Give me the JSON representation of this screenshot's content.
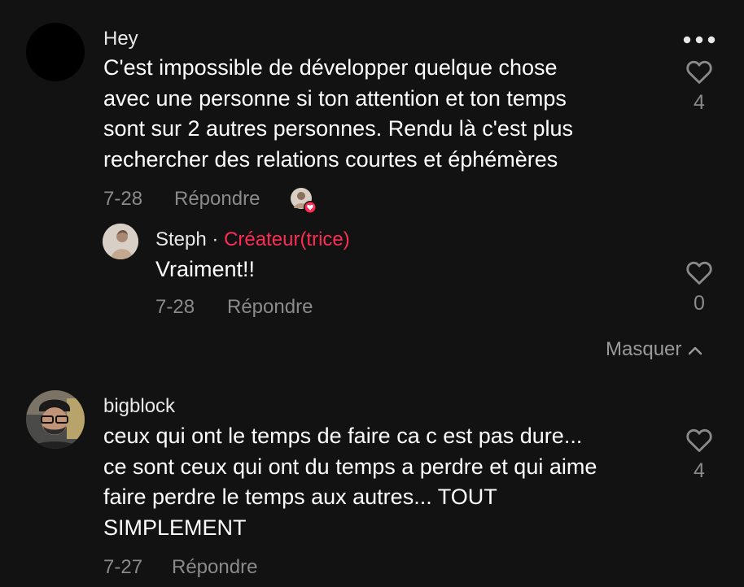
{
  "comments": [
    {
      "username": "Hey",
      "text_lines": [
        "C'est impossible de développer quelque chose",
        "avec une personne si ton attention et ton temps",
        "sont sur 2 autres personnes. Rendu là c'est plus",
        "rechercher des relations courtes et éphémères"
      ],
      "date": "7-28",
      "reply_label": "Répondre",
      "likes": "4",
      "replies": [
        {
          "username": "Steph",
          "separator": "·",
          "creator_label": "Créateur(trice)",
          "text_lines": [
            "Vraiment!!"
          ],
          "date": "7-28",
          "reply_label": "Répondre",
          "likes": "0"
        }
      ],
      "hide_label": "Masquer"
    },
    {
      "username": "bigblock",
      "text_lines": [
        "ceux qui ont le temps de faire ca c est pas dure...",
        "ce sont ceux qui ont du temps a perdre et qui aime",
        "faire perdre le temps aux autres... TOUT",
        "SIMPLEMENT"
      ],
      "date": "7-27",
      "reply_label": "Répondre",
      "likes": "4"
    }
  ],
  "colors": {
    "background": "#121212",
    "creator_accent": "#fe2c55",
    "muted_text": "#8a8a8a"
  },
  "icons": {
    "more": "more-horizontal-icon",
    "like": "heart-outline-icon",
    "collapse": "chevron-up-icon",
    "creator_liked": "creator-liked-heart-badge"
  }
}
